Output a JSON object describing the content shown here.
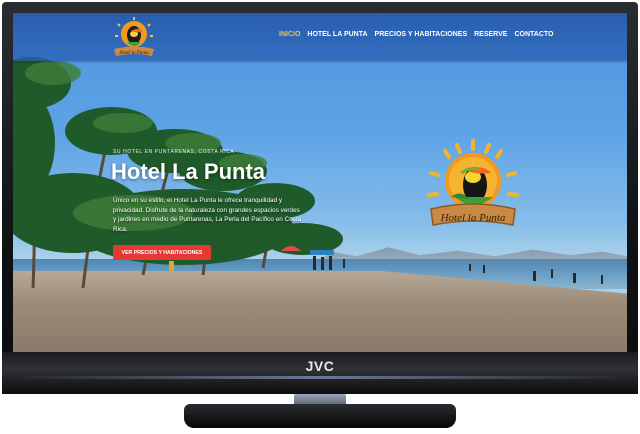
{
  "device": {
    "brand": "JVC"
  },
  "site": {
    "logo_text": "Hotel la Punta",
    "nav": {
      "items": [
        {
          "label": "INICIO",
          "active": true
        },
        {
          "label": "HOTEL LA PUNTA",
          "active": false
        },
        {
          "label": "PRECIOS Y HABITACIONES",
          "active": false
        },
        {
          "label": "RESERVE",
          "active": false
        },
        {
          "label": "CONTACTO",
          "active": false
        }
      ]
    },
    "hero": {
      "kicker": "SU HOTEL EN PUNTARENAS, COSTA RICA",
      "title": "Hotel La Punta",
      "description": "Único en su estilo, el Hotel La Punta le ofrece tranquilidad y privacidad. Disfrute de la naturaleza con grandes espacios verdes y jardines en medio de Puntarenas, La Perla del Pacífico en Costa Rica.",
      "button_label": "VER PRECIOS Y HABITACIONES"
    }
  },
  "colors": {
    "accent": "#e53935",
    "nav_active": "#f5c04a",
    "nav_bg": "#2b5fae"
  }
}
